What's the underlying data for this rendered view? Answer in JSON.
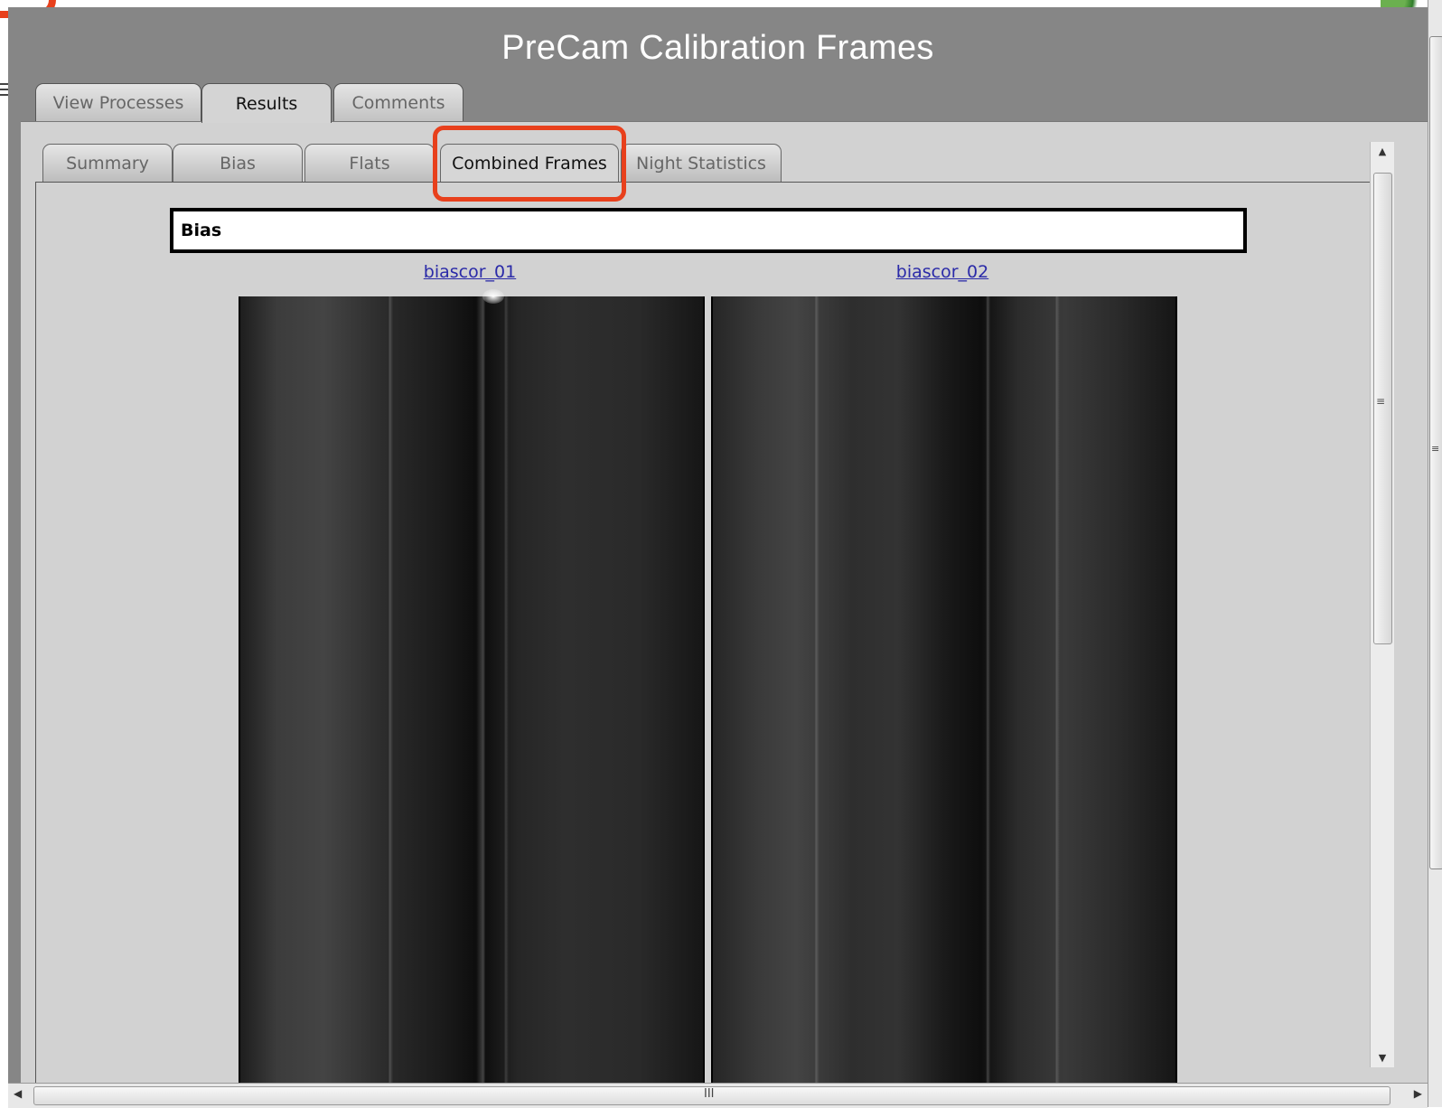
{
  "window": {
    "title": "PreCam Calibration Frames"
  },
  "top_tabs": [
    {
      "label": "View Processes",
      "active": false
    },
    {
      "label": "Results",
      "active": true
    },
    {
      "label": "Comments",
      "active": false
    }
  ],
  "sub_tabs": [
    {
      "label": "Summary",
      "active": false
    },
    {
      "label": "Bias",
      "active": false
    },
    {
      "label": "Flats",
      "active": false
    },
    {
      "label": "Combined Frames",
      "active": true
    },
    {
      "label": "Night Statistics",
      "active": false
    }
  ],
  "highlight_color": "#e8401c",
  "section": {
    "title": "Bias"
  },
  "frames": [
    {
      "name": "biascor_01"
    },
    {
      "name": "biascor_02"
    }
  ],
  "scrollbars": {
    "up_icon": "arrow-up-icon",
    "left_icon": "arrow-left-icon",
    "right_icon": "arrow-right-icon",
    "grip_h": "III",
    "grip_v": "≡"
  }
}
